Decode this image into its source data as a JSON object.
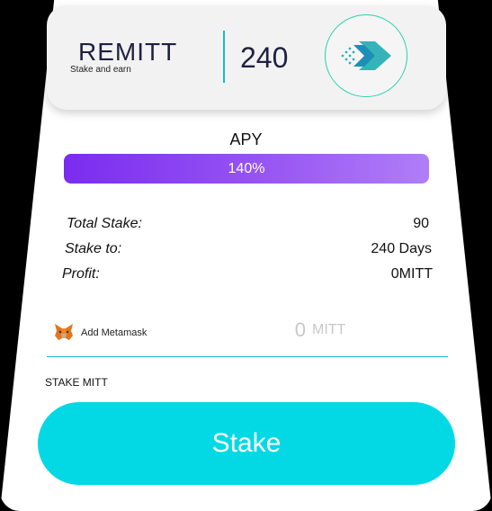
{
  "header": {
    "brand_name": "REMITT",
    "brand_tagline": "Stake and earn",
    "duration_value": "240",
    "logo_icon": "remitt-arrow-logo-icon"
  },
  "apy": {
    "label": "APY",
    "value_text": "140%",
    "fill_fraction": 1.0,
    "gradient_colors": [
      "#7a2cf0",
      "#b07ef7"
    ]
  },
  "details": [
    {
      "label": "Total Stake:",
      "value": "90"
    },
    {
      "label": "Stake to:",
      "value": "240 Days"
    },
    {
      "label": "Profit:",
      "value": "0MITT"
    }
  ],
  "wallet": {
    "icon": "metamask-fox-icon",
    "label": "Add Metamask"
  },
  "amount": {
    "value": "0",
    "unit": "MITT"
  },
  "stake": {
    "caption": "STAKE MITT",
    "button_label": "Stake",
    "button_color": "#02d9e5"
  },
  "colors": {
    "accent": "#15b9c7",
    "text_dark": "#1f2040"
  }
}
